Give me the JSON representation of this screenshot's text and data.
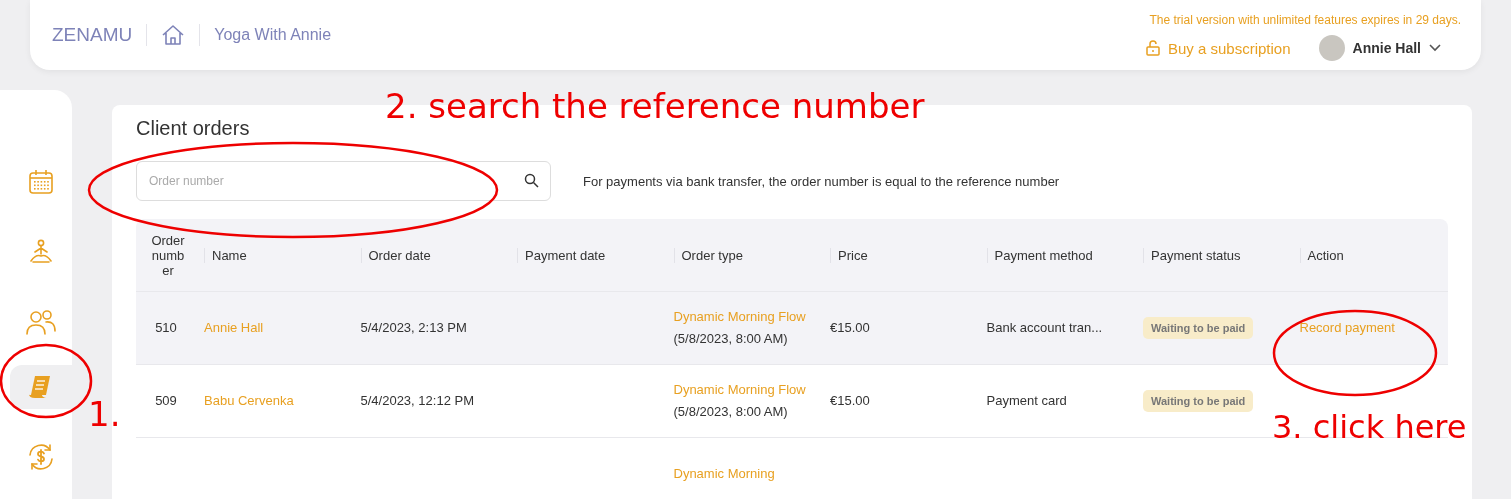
{
  "header": {
    "logo": "ZENAMU",
    "studio": "Yoga With Annie",
    "trial_notice": "The trial version with unlimited features expires in 29 days.",
    "subscribe": "Buy a subscription",
    "user": "Annie Hall"
  },
  "sidebar": {
    "items": [
      {
        "selected": false
      },
      {
        "selected": false
      },
      {
        "selected": false
      },
      {
        "selected": true
      },
      {
        "selected": false
      }
    ]
  },
  "page": {
    "title": "Client orders",
    "search": {
      "placeholder": "Order number"
    },
    "hint": "For payments via bank transfer, the order number is equal to the reference number"
  },
  "table": {
    "columns": [
      "Order numb er",
      "Name",
      "Order date",
      "Payment date",
      "Order type",
      "Price",
      "Payment method",
      "Payment status",
      "Action"
    ],
    "rows": [
      {
        "number": "510",
        "name": "Annie Hall",
        "order_date": "5/4/2023, 2:13 PM",
        "payment_date": "",
        "order_type": "Dynamic Morning Flow",
        "order_when": " (5/8/2023, 8:00 AM)",
        "price": "€15.00",
        "method": "Bank account tran...",
        "status": "Waiting to be paid",
        "action": "Record payment",
        "selected": true
      },
      {
        "number": "509",
        "name": "Babu Cervenka",
        "order_date": "5/4/2023, 12:12 PM",
        "payment_date": "",
        "order_type": "Dynamic Morning Flow",
        "order_when": " (5/8/2023, 8:00 AM)",
        "price": "€15.00",
        "method": "Payment card",
        "status": "Waiting to be paid",
        "action": "",
        "selected": false
      },
      {
        "number": "",
        "name": "",
        "order_date": "",
        "payment_date": "",
        "order_type": "Dynamic Morning",
        "order_when": "",
        "price": "",
        "method": "",
        "status": "",
        "action": "",
        "selected": false
      }
    ]
  },
  "annotations": [
    {
      "kind": "step",
      "text": "2. search the reference number"
    },
    {
      "kind": "step",
      "text": "1."
    },
    {
      "kind": "step",
      "text": "3. click here"
    }
  ]
}
